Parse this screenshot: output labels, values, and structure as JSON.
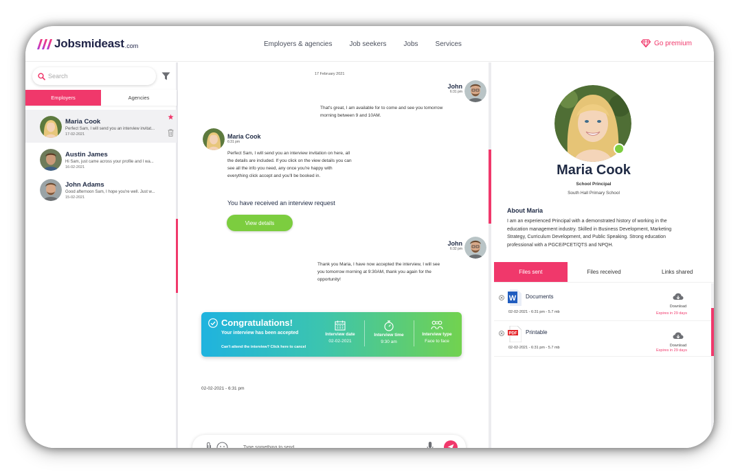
{
  "brand": {
    "name": "Jobsmideast",
    "tld": ".com",
    "accent": "#f0386b",
    "green": "#7ccd3f"
  },
  "nav": {
    "items": [
      "Employers & agencies",
      "Job seekers",
      "Jobs",
      "Services"
    ],
    "premium": "Go premium"
  },
  "sidebar": {
    "search_placeholder": "Search",
    "tabs": [
      "Employers",
      "Agencies"
    ],
    "contacts": [
      {
        "name": "Maria Cook",
        "preview": "Perfect Sam, I will send you an interview invitat...",
        "date": "17-02-2021"
      },
      {
        "name": "Austin James",
        "preview": "Hi Sam, just came across your profile and I wa...",
        "date": "16-02-2021"
      },
      {
        "name": "John Adams",
        "preview": "Good afternoon Sam, I hope you're well. Just w...",
        "date": "15-02-2021"
      }
    ]
  },
  "chat": {
    "date_header": "17 February 2021",
    "m1": {
      "name": "John",
      "time": "6:31 pm",
      "lines": [
        "That's great, I am available for to come and see you tomorrow",
        "morning between 9 and 10AM."
      ]
    },
    "m2": {
      "name": "Maria Cook",
      "time": "6:31 pm",
      "lines": [
        "Perfect Sam, I will send you an interview invitation on here, all",
        "the details are included. If you click on the view details you can",
        "see all the info you need, any once you're happy with",
        "everything click accept and you'll be booked in."
      ]
    },
    "request_text": "You have received an interview request",
    "view_button": "View details",
    "m3": {
      "name": "John",
      "time": "6:32 pm",
      "lines": [
        "Thank you Maria, I have now accepted the interview, I will see",
        "you tomorrow morning at 9:30AM, thank you again for the",
        "opportunity!"
      ]
    },
    "congrats": {
      "title": "Congratulations!",
      "subtitle": "Your interview has been accepted",
      "cancel": "Can't attend the interview? Click here to cancel",
      "date_label": "Interview date",
      "date_value": "02-02-2021",
      "time_label": "Interview time",
      "time_value": "9:30 am",
      "type_label": "Interview type",
      "type_value": "Face to face"
    },
    "congrats_timestamp": "02-02-2021 - 6:31 pm",
    "composer_placeholder": "Type something to send"
  },
  "profile": {
    "name": "Maria Cook",
    "role": "School Principal",
    "school": "South Hall Primary School",
    "about_title": "About Maria",
    "about_lines": [
      "I am an experienced Principal with a demonstrated history of working in the",
      "education management industry. Skilled in Business Development, Marketing",
      "Strategy, Curriculum Development, and Public Speaking. Strong education",
      "professional with a PGCE/PCET/QTS and NPQH."
    ],
    "tabs": [
      "Files sent",
      "Files received",
      "Links shared"
    ],
    "files": [
      {
        "name": "Documents",
        "meta": "02-02-2021 - 6:31 pm - 5.7 mb",
        "download": "Download",
        "expires": "Expires in 29 days",
        "icon": "word-doc-icon"
      },
      {
        "name": "Printable",
        "meta": "02-02-2021 - 6:31 pm - 5.7 mb",
        "download": "Download",
        "expires": "Expires in 29 days",
        "icon": "pdf-icon"
      }
    ]
  }
}
